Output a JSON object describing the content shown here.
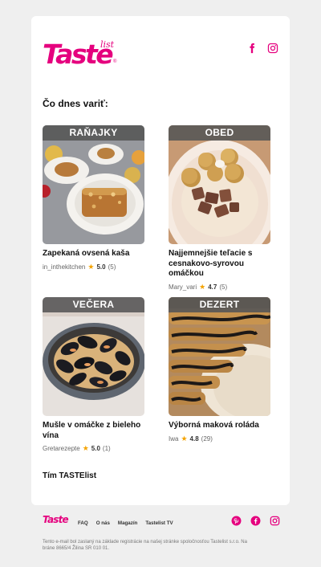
{
  "brand": {
    "name": "Taste",
    "sub": "list",
    "reg": "®",
    "color": "#e5007e"
  },
  "header": {
    "social": [
      "facebook-icon",
      "instagram-icon"
    ]
  },
  "intro": "Čo dnes variť:",
  "recipes": [
    {
      "category": "RAŇAJKY",
      "title": "Zapekaná ovsená kaša",
      "author": "in_inthekitchen",
      "rating": "5.0",
      "reviews": "(5)"
    },
    {
      "category": "OBED",
      "title": "Najjemnejšie teľacie s cesnakovo-syrovou omáčkou",
      "author": "Mary_vari",
      "rating": "4.7",
      "reviews": "(5)"
    },
    {
      "category": "VEČERA",
      "title": "Mušle v omáčke z bieleho vína",
      "author": "Gretarezepte",
      "rating": "5.0",
      "reviews": "(1)"
    },
    {
      "category": "DEZERT",
      "title": "Výborná maková roláda",
      "author": "Iwa",
      "rating": "4.8",
      "reviews": "(29)"
    }
  ],
  "signoff": "Tím TASTElist",
  "footer": {
    "links": [
      "FAQ",
      "O nás",
      "Magazín",
      "Tastelist TV"
    ],
    "social": [
      "pinterest-icon",
      "facebook-icon",
      "instagram-icon"
    ],
    "legal": "Tento e-mail bol zaslaný na základe registrácie na našej stránke spoločnosťou Tastelist s.r.o. Na bráne 8665/4 Žilina SR 010 01."
  }
}
